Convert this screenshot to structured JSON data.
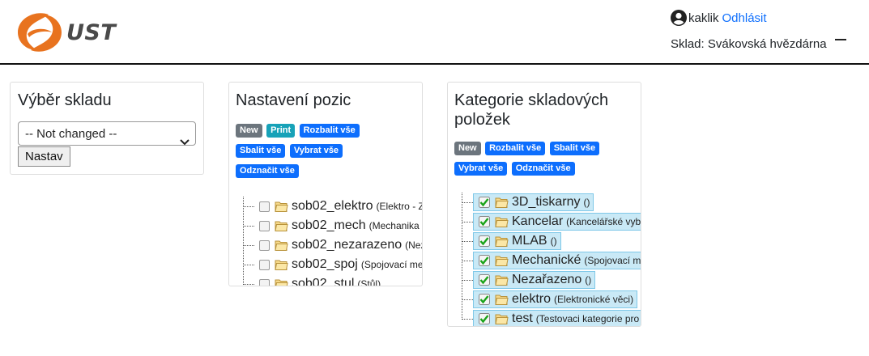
{
  "header": {
    "logo_text": "UST",
    "user_name": "kaklik",
    "logout_label": "Odhlásit",
    "store_label": "Sklad: Svákovská hvězdárna",
    "accent_color": "#e8731f"
  },
  "panel_store": {
    "title": "Výběr skladu",
    "select_value": "-- Not changed --",
    "submit_label": "Nastav"
  },
  "panel_positions": {
    "title": "Nastavení pozic",
    "buttons": {
      "new": "New",
      "print": "Print",
      "expand": "Rozbalit vše",
      "collapse": "Sbalit vše",
      "select_all": "Vybrat vše",
      "deselect_all": "Odznačit vše"
    },
    "items": [
      {
        "name": "sob02_elektro",
        "desc": "(Elektro - Z"
      },
      {
        "name": "sob02_mech",
        "desc": "(Mechanika"
      },
      {
        "name": "sob02_nezarazeno",
        "desc": "(Nez"
      },
      {
        "name": "sob02_spoj",
        "desc": "(Spojovací me"
      },
      {
        "name": "sob02_stul",
        "desc": "(Stůl)"
      }
    ]
  },
  "panel_categories": {
    "title": "Kategorie skladových položek",
    "buttons": {
      "new": "New",
      "expand": "Rozbalit vše",
      "collapse": "Sbalit vše",
      "select_all": "Vybrat vše",
      "deselect_all": "Odznačit vše"
    },
    "items": [
      {
        "name": "3D_tiskarny",
        "desc": "()"
      },
      {
        "name": "Kancelar",
        "desc": "(Kancelářské vyb"
      },
      {
        "name": "MLAB",
        "desc": "()"
      },
      {
        "name": "Mechanické",
        "desc": "(Spojovací m"
      },
      {
        "name": "Nezařazeno",
        "desc": "()"
      },
      {
        "name": "elektro",
        "desc": "(Elektronické věci)"
      },
      {
        "name": "test",
        "desc": "(Testovaci kategorie pro"
      }
    ]
  }
}
